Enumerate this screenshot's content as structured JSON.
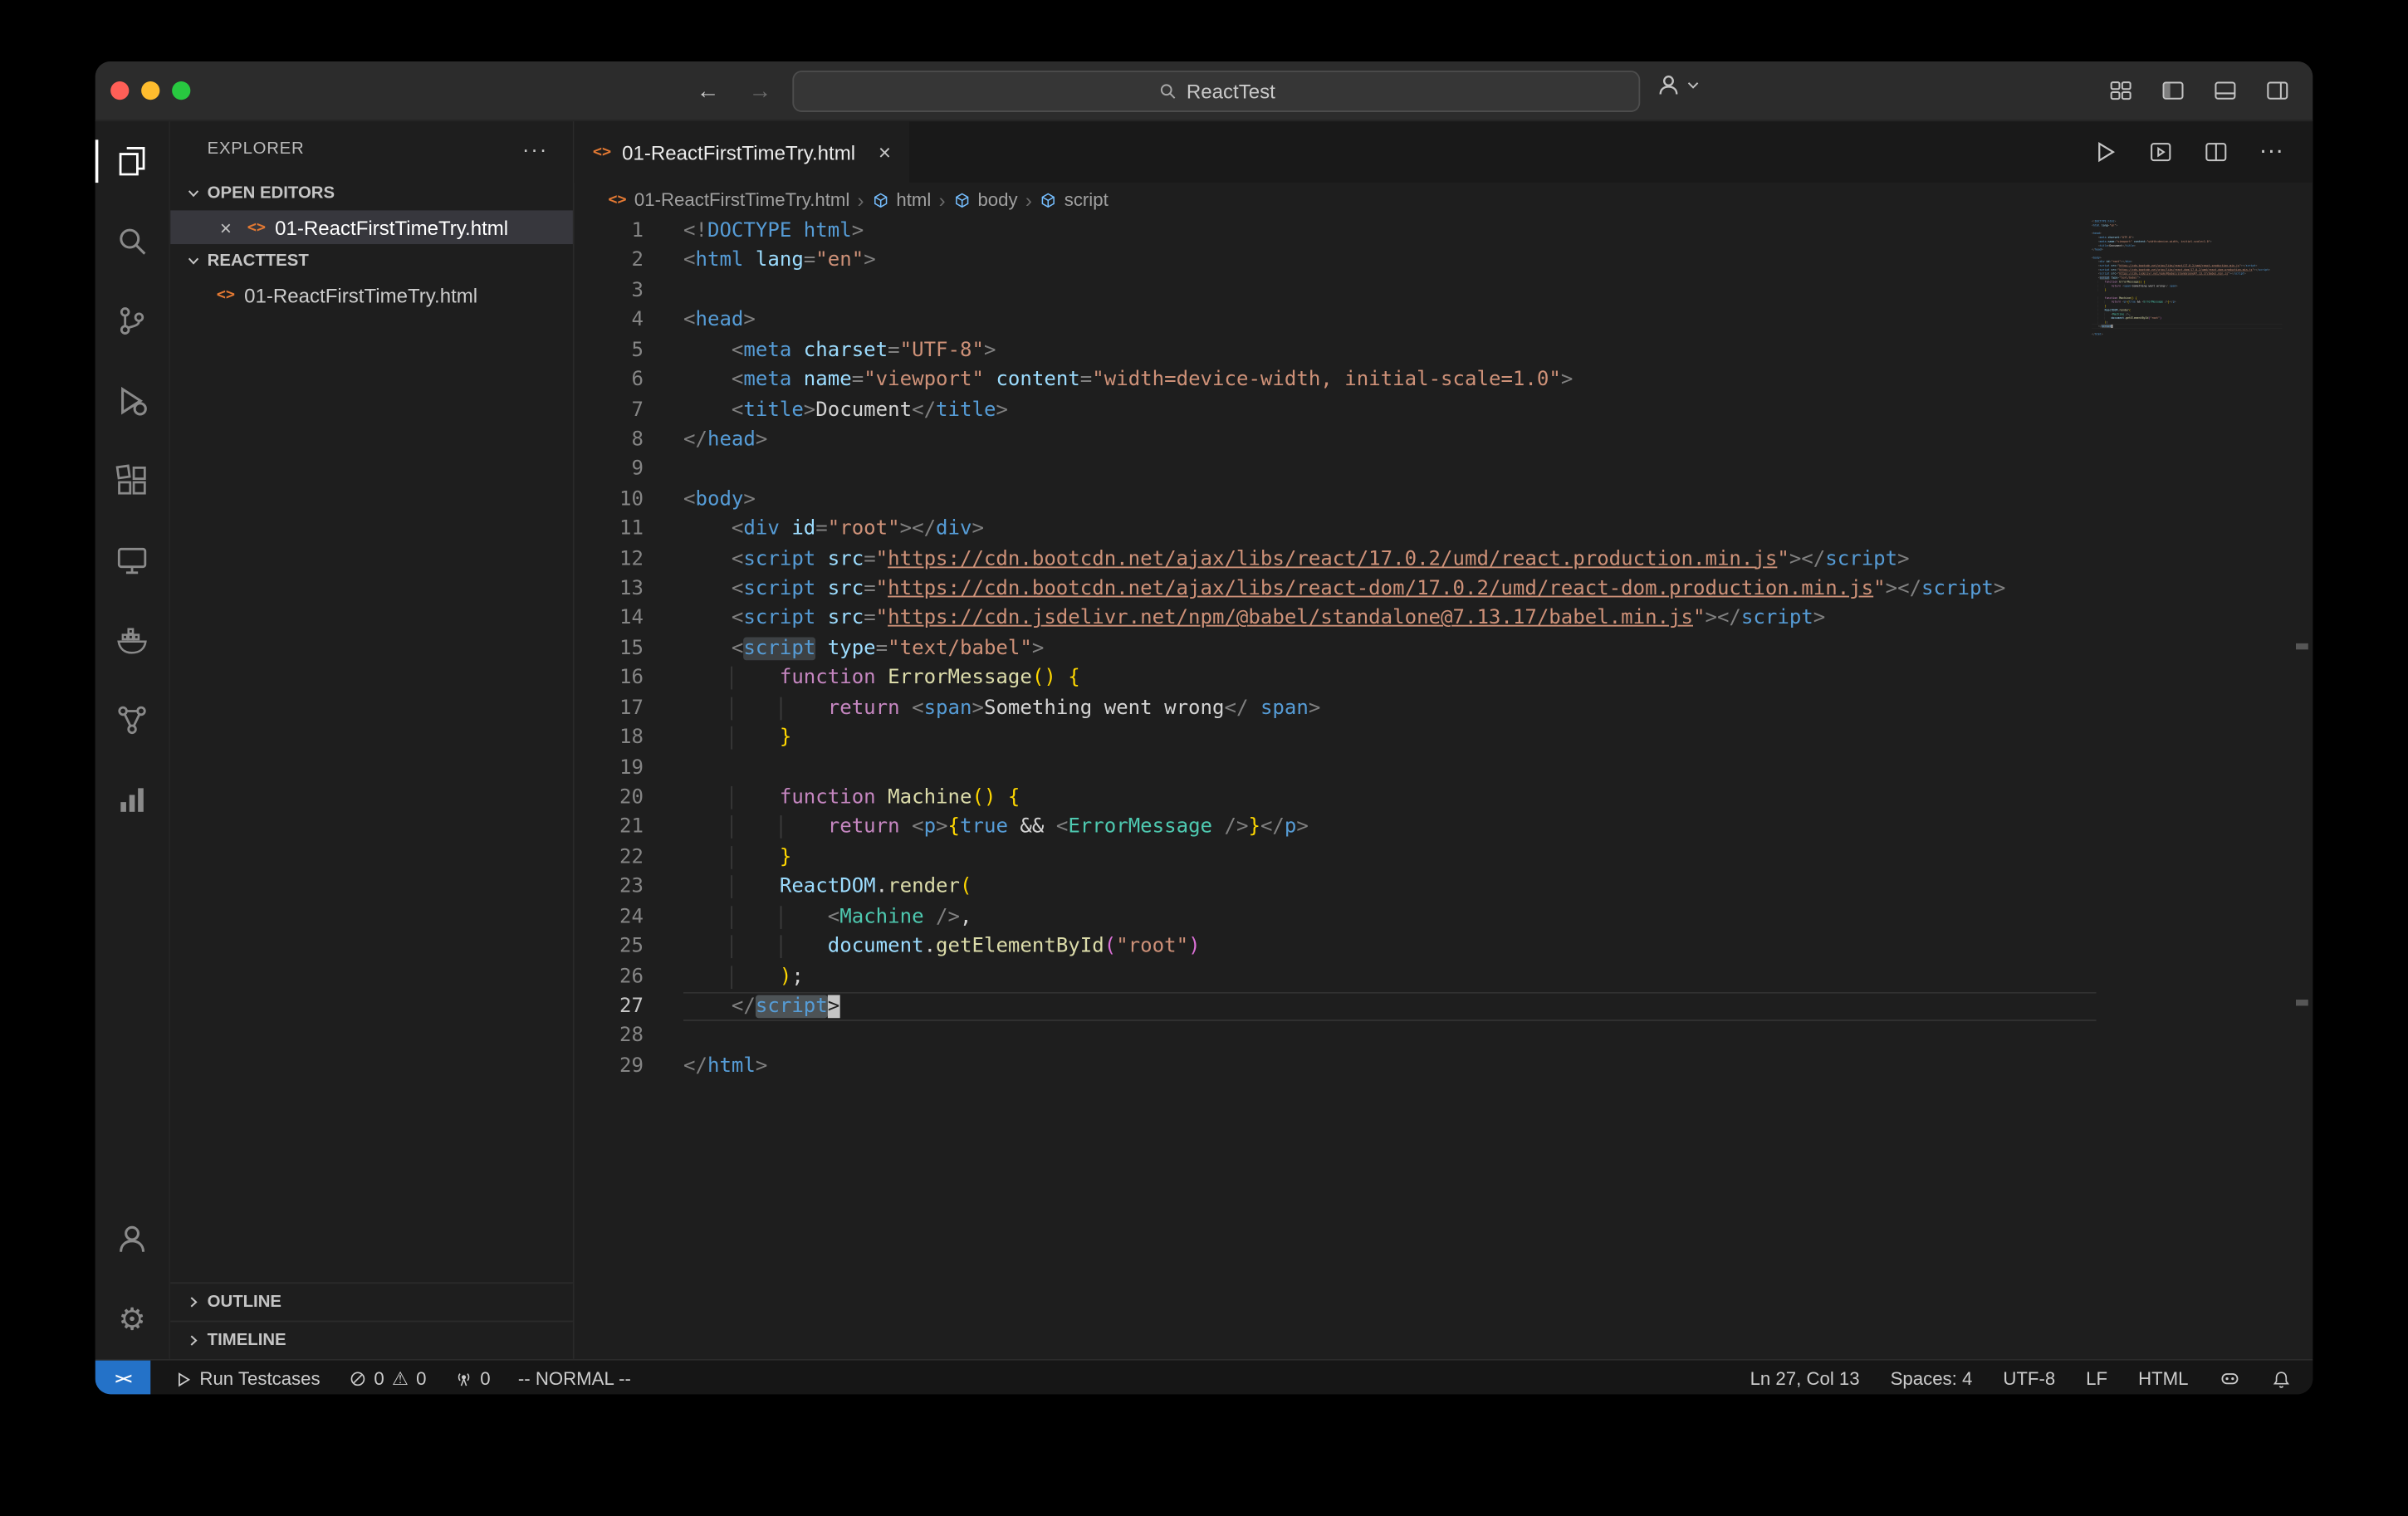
{
  "window": {
    "traffic_lights": [
      "#ff5f57",
      "#febc2e",
      "#28c840"
    ]
  },
  "icons": {
    "back": "←",
    "forward": "→",
    "more": "···",
    "close": "×",
    "warning": "⚠",
    "gear": "⚙",
    "remote": "><",
    "crumb_sep": "›"
  },
  "titlebar": {
    "search_label": "ReactTest"
  },
  "activity_bar": {
    "items": [
      "explorer",
      "search",
      "source-control",
      "run-debug",
      "extensions",
      "remote-explorer",
      "docker",
      "graph-nodes",
      "bar-chart"
    ],
    "bottom": [
      "account",
      "settings"
    ]
  },
  "explorer": {
    "title": "EXPLORER",
    "open_editors_label": "OPEN EDITORS",
    "open_editor_file": "01-ReactFirstTimeTry.html",
    "workspace_label": "REACTTEST",
    "tree_file": "01-ReactFirstTimeTry.html",
    "outline_label": "OUTLINE",
    "timeline_label": "TIMELINE"
  },
  "tab": {
    "title": "01-ReactFirstTimeTry.html"
  },
  "breadcrumbs": [
    "01-ReactFirstTimeTry.html",
    "html",
    "body",
    "script"
  ],
  "editor": {
    "cursor": {
      "line": 27,
      "col": 13
    },
    "lines": [
      {
        "n": 1,
        "t": [
          [
            "g",
            "<!"
          ],
          [
            "b",
            "DOCTYPE"
          ],
          [
            "w",
            " "
          ],
          [
            "b",
            "html"
          ],
          [
            "g",
            ">"
          ]
        ]
      },
      {
        "n": 2,
        "t": [
          [
            "g",
            "<"
          ],
          [
            "b",
            "html"
          ],
          [
            "w",
            " "
          ],
          [
            "a",
            "lang"
          ],
          [
            "g",
            "="
          ],
          [
            "s",
            "\"en\""
          ],
          [
            "g",
            ">"
          ]
        ]
      },
      {
        "n": 3,
        "t": []
      },
      {
        "n": 4,
        "t": [
          [
            "g",
            "<"
          ],
          [
            "b",
            "head"
          ],
          [
            "g",
            ">"
          ]
        ]
      },
      {
        "n": 5,
        "t": [
          [
            "i",
            "    "
          ],
          [
            "g",
            "<"
          ],
          [
            "b",
            "meta"
          ],
          [
            "w",
            " "
          ],
          [
            "a",
            "charset"
          ],
          [
            "g",
            "="
          ],
          [
            "s",
            "\"UTF-8\""
          ],
          [
            "g",
            ">"
          ]
        ]
      },
      {
        "n": 6,
        "t": [
          [
            "i",
            "    "
          ],
          [
            "g",
            "<"
          ],
          [
            "b",
            "meta"
          ],
          [
            "w",
            " "
          ],
          [
            "a",
            "name"
          ],
          [
            "g",
            "="
          ],
          [
            "s",
            "\"viewport\""
          ],
          [
            "w",
            " "
          ],
          [
            "a",
            "content"
          ],
          [
            "g",
            "="
          ],
          [
            "s",
            "\"width=device-width, initial-scale=1.0\""
          ],
          [
            "g",
            ">"
          ]
        ]
      },
      {
        "n": 7,
        "t": [
          [
            "i",
            "    "
          ],
          [
            "g",
            "<"
          ],
          [
            "b",
            "title"
          ],
          [
            "g",
            ">"
          ],
          [
            "w",
            "Document"
          ],
          [
            "g",
            "</"
          ],
          [
            "b",
            "title"
          ],
          [
            "g",
            ">"
          ]
        ]
      },
      {
        "n": 8,
        "t": [
          [
            "g",
            "</"
          ],
          [
            "b",
            "head"
          ],
          [
            "g",
            ">"
          ]
        ]
      },
      {
        "n": 9,
        "t": []
      },
      {
        "n": 10,
        "t": [
          [
            "g",
            "<"
          ],
          [
            "b",
            "body"
          ],
          [
            "g",
            ">"
          ]
        ]
      },
      {
        "n": 11,
        "t": [
          [
            "i",
            "    "
          ],
          [
            "g",
            "<"
          ],
          [
            "b",
            "div"
          ],
          [
            "w",
            " "
          ],
          [
            "a",
            "id"
          ],
          [
            "g",
            "="
          ],
          [
            "s",
            "\"root\""
          ],
          [
            "g",
            ">"
          ],
          [
            "g",
            "</"
          ],
          [
            "b",
            "div"
          ],
          [
            "g",
            ">"
          ]
        ]
      },
      {
        "n": 12,
        "t": [
          [
            "i",
            "    "
          ],
          [
            "g",
            "<"
          ],
          [
            "b",
            "script"
          ],
          [
            "w",
            " "
          ],
          [
            "a",
            "src"
          ],
          [
            "g",
            "="
          ],
          [
            "s",
            "\""
          ],
          [
            "u",
            "https://cdn.bootcdn.net/ajax/libs/react/17.0.2/umd/react.production.min.js"
          ],
          [
            "s",
            "\""
          ],
          [
            "g",
            ">"
          ],
          [
            "g",
            "</"
          ],
          [
            "b",
            "script"
          ],
          [
            "g",
            ">"
          ]
        ]
      },
      {
        "n": 13,
        "t": [
          [
            "i",
            "    "
          ],
          [
            "g",
            "<"
          ],
          [
            "b",
            "script"
          ],
          [
            "w",
            " "
          ],
          [
            "a",
            "src"
          ],
          [
            "g",
            "="
          ],
          [
            "s",
            "\""
          ],
          [
            "u",
            "https://cdn.bootcdn.net/ajax/libs/react-dom/17.0.2/umd/react-dom.production.min.js"
          ],
          [
            "s",
            "\""
          ],
          [
            "g",
            ">"
          ],
          [
            "g",
            "</"
          ],
          [
            "b",
            "script"
          ],
          [
            "g",
            ">"
          ]
        ]
      },
      {
        "n": 14,
        "t": [
          [
            "i",
            "    "
          ],
          [
            "g",
            "<"
          ],
          [
            "b",
            "script"
          ],
          [
            "w",
            " "
          ],
          [
            "a",
            "src"
          ],
          [
            "g",
            "="
          ],
          [
            "s",
            "\""
          ],
          [
            "u",
            "https://cdn.jsdelivr.net/npm/@babel/standalone@7.13.17/babel.min.js"
          ],
          [
            "s",
            "\""
          ],
          [
            "g",
            ">"
          ],
          [
            "g",
            "</"
          ],
          [
            "b",
            "script"
          ],
          [
            "g",
            ">"
          ]
        ]
      },
      {
        "n": 15,
        "t": [
          [
            "i",
            "    "
          ],
          [
            "g",
            "<"
          ],
          [
            "b hl",
            "script"
          ],
          [
            "w",
            " "
          ],
          [
            "a",
            "type"
          ],
          [
            "g",
            "="
          ],
          [
            "s",
            "\"text/babel\""
          ],
          [
            "g",
            ">"
          ]
        ]
      },
      {
        "n": 16,
        "t": [
          [
            "i",
            "    "
          ],
          [
            "i",
            "    "
          ],
          [
            "k",
            "function"
          ],
          [
            "w",
            " "
          ],
          [
            "f",
            "ErrorMessage"
          ],
          [
            "y",
            "()"
          ],
          [
            "w",
            " "
          ],
          [
            "y",
            "{"
          ]
        ]
      },
      {
        "n": 17,
        "t": [
          [
            "i",
            "    "
          ],
          [
            "i",
            "    "
          ],
          [
            "i",
            "    "
          ],
          [
            "k",
            "return"
          ],
          [
            "w",
            " "
          ],
          [
            "g",
            "<"
          ],
          [
            "b",
            "span"
          ],
          [
            "g",
            ">"
          ],
          [
            "w",
            "Something went wrong"
          ],
          [
            "g",
            "</"
          ],
          [
            "w",
            " "
          ],
          [
            "b",
            "span"
          ],
          [
            "g",
            ">"
          ]
        ]
      },
      {
        "n": 18,
        "t": [
          [
            "i",
            "    "
          ],
          [
            "i",
            "    "
          ],
          [
            "y",
            "}"
          ]
        ]
      },
      {
        "n": 19,
        "t": []
      },
      {
        "n": 20,
        "t": [
          [
            "i",
            "    "
          ],
          [
            "i",
            "    "
          ],
          [
            "k",
            "function"
          ],
          [
            "w",
            " "
          ],
          [
            "f",
            "Machine"
          ],
          [
            "y",
            "()"
          ],
          [
            "w",
            " "
          ],
          [
            "y",
            "{"
          ]
        ]
      },
      {
        "n": 21,
        "t": [
          [
            "i",
            "    "
          ],
          [
            "i",
            "    "
          ],
          [
            "i",
            "    "
          ],
          [
            "k",
            "return"
          ],
          [
            "w",
            " "
          ],
          [
            "g",
            "<"
          ],
          [
            "b",
            "p"
          ],
          [
            "g",
            ">"
          ],
          [
            "y",
            "{"
          ],
          [
            "b",
            "true"
          ],
          [
            "w",
            " && "
          ],
          [
            "g",
            "<"
          ],
          [
            "C",
            "ErrorMessage"
          ],
          [
            "w",
            " "
          ],
          [
            "g",
            "/>"
          ],
          [
            "y",
            "}"
          ],
          [
            "g",
            "</"
          ],
          [
            "b",
            "p"
          ],
          [
            "g",
            ">"
          ]
        ]
      },
      {
        "n": 22,
        "t": [
          [
            "i",
            "    "
          ],
          [
            "i",
            "    "
          ],
          [
            "y",
            "}"
          ]
        ]
      },
      {
        "n": 23,
        "t": [
          [
            "i",
            "    "
          ],
          [
            "i",
            "    "
          ],
          [
            "v",
            "ReactDOM"
          ],
          [
            "w",
            "."
          ],
          [
            "f",
            "render"
          ],
          [
            "y",
            "("
          ]
        ]
      },
      {
        "n": 24,
        "t": [
          [
            "i",
            "    "
          ],
          [
            "i",
            "    "
          ],
          [
            "i",
            "    "
          ],
          [
            "g",
            "<"
          ],
          [
            "C",
            "Machine"
          ],
          [
            "w",
            " "
          ],
          [
            "g",
            "/>"
          ],
          [
            "w",
            ","
          ]
        ]
      },
      {
        "n": 25,
        "t": [
          [
            "i",
            "    "
          ],
          [
            "i",
            "    "
          ],
          [
            "i",
            "    "
          ],
          [
            "v",
            "document"
          ],
          [
            "w",
            "."
          ],
          [
            "f",
            "getElementById"
          ],
          [
            "p",
            "("
          ],
          [
            "s",
            "\"root\""
          ],
          [
            "p",
            ")"
          ]
        ]
      },
      {
        "n": 26,
        "t": [
          [
            "i",
            "    "
          ],
          [
            "i",
            "    "
          ],
          [
            "y",
            ")"
          ],
          [
            "w",
            ";"
          ]
        ]
      },
      {
        "n": 27,
        "cur": true,
        "t": [
          [
            "i",
            "    "
          ],
          [
            "g",
            "</"
          ],
          [
            "b sel",
            "script"
          ],
          [
            "cur",
            ">"
          ]
        ]
      },
      {
        "n": 28,
        "t": []
      },
      {
        "n": 29,
        "t": [
          [
            "g",
            "</"
          ],
          [
            "b",
            "html"
          ],
          [
            "g",
            ">"
          ]
        ]
      }
    ]
  },
  "status_bar": {
    "remote_bg": "#2472c8",
    "run_tests": "Run Testcases",
    "errors": "0",
    "warnings": "0",
    "ports": "0",
    "mode": "-- NORMAL --",
    "cursor": "Ln 27, Col 13",
    "spaces": "Spaces: 4",
    "encoding": "UTF-8",
    "eol": "LF",
    "language": "HTML"
  }
}
